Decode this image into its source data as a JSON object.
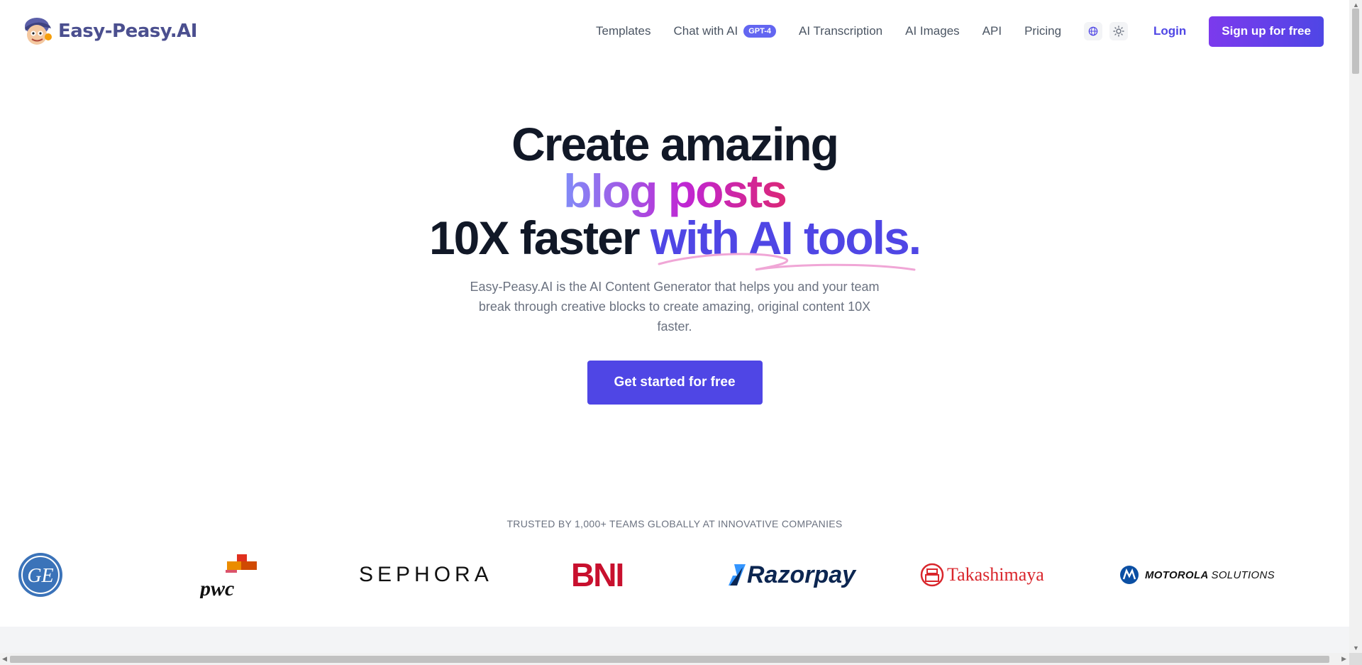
{
  "nav": {
    "logo_text": "Easy-Peasy.AI",
    "links": {
      "templates": "Templates",
      "chat": "Chat with AI",
      "chat_badge": "GPT-4",
      "transcription": "AI Transcription",
      "images": "AI Images",
      "api": "API",
      "pricing": "Pricing"
    },
    "language_icon": "globe-icon",
    "theme_icon": "sun-icon",
    "login": "Login",
    "signup": "Sign up for free"
  },
  "hero": {
    "line1": "Create amazing",
    "line2": "blog posts",
    "line3_plain": "10X faster ",
    "line3_accent": "with AI tools.",
    "subtitle": "Easy-Peasy.AI is the AI Content Generator that helps you and your team break through creative blocks to create amazing, original content 10X faster.",
    "cta": "Get started for free"
  },
  "trusted": {
    "label": "TRUSTED BY 1,000+ TEAMS GLOBALLY AT INNOVATIVE COMPANIES",
    "brands": {
      "ge": "GE",
      "pwc": "pwc",
      "sephora": "SEPHORA",
      "bni": "BNI",
      "razorpay": "Razorpay",
      "takashimaya": "Takashimaya",
      "motorola_bold": "MOTOROLA",
      "motorola_light": "SOLUTIONS"
    }
  },
  "colors": {
    "primary": "#4f46e5",
    "signup_gradient_start": "#7c3aed",
    "gradient_text_start": "#818cf8",
    "gradient_text_end": "#db2777"
  }
}
